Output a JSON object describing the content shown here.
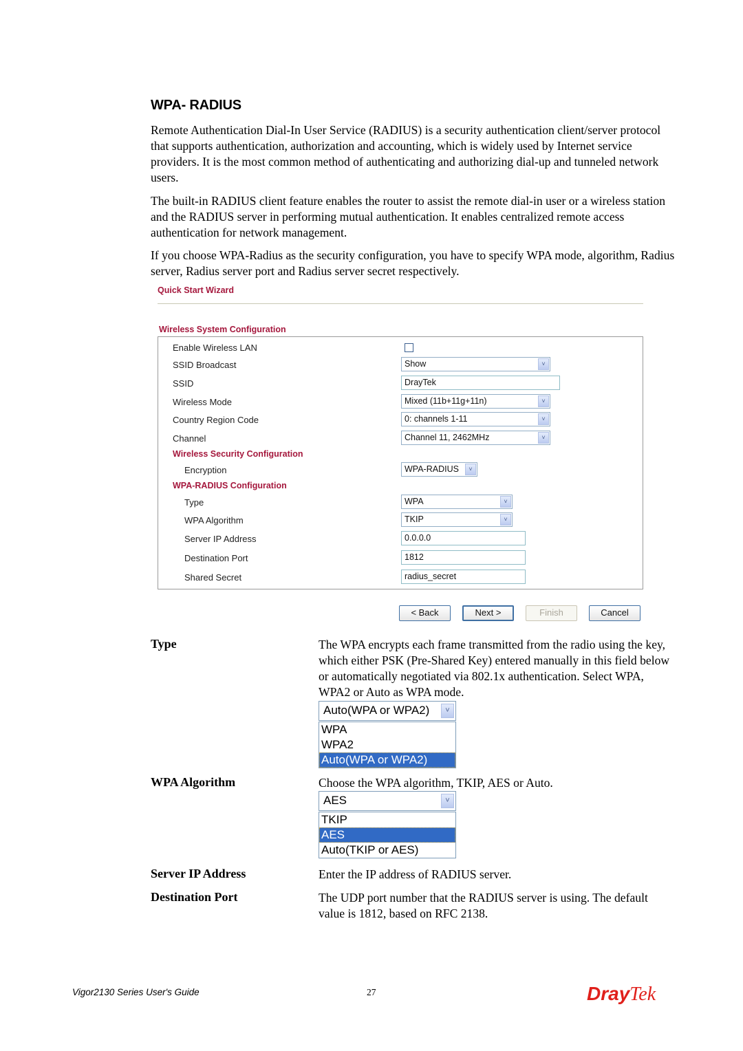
{
  "heading": "WPA- RADIUS",
  "paragraphs": [
    "Remote Authentication Dial-In User Service (RADIUS) is a security authentication client/server protocol that supports authentication, authorization and accounting, which is widely used by Internet service providers. It is the most common method of authenticating and authorizing dial-up and tunneled network users.",
    "The built-in RADIUS client feature enables the router to assist the remote dial-in user or a wireless station and the RADIUS server in performing mutual authentication. It enables centralized remote access authentication for network management.",
    "If you choose WPA-Radius as the security configuration, you have to specify WPA mode, algorithm, Radius server, Radius server port and Radius server secret respectively."
  ],
  "ui": {
    "wizard_title": "Quick Start Wizard",
    "system_section": "Wireless System Configuration",
    "fields": {
      "enable_wlan": {
        "label": "Enable Wireless LAN",
        "checked": false
      },
      "ssid_broadcast": {
        "label": "SSID Broadcast",
        "value": "Show"
      },
      "ssid": {
        "label": "SSID",
        "value": "DrayTek"
      },
      "wireless_mode": {
        "label": "Wireless Mode",
        "value": "Mixed (11b+11g+11n)"
      },
      "country_region": {
        "label": "Country Region Code",
        "value": "0: channels 1-11"
      },
      "channel": {
        "label": "Channel",
        "value": "Channel 11, 2462MHz"
      }
    },
    "security_section": "Wireless Security Configuration",
    "encryption": {
      "label": "Encryption",
      "value": "WPA-RADIUS"
    },
    "radius_section": "WPA-RADIUS Configuration",
    "radius": {
      "type": {
        "label": "Type",
        "value": "WPA"
      },
      "algorithm": {
        "label": "WPA Algorithm",
        "value": "TKIP"
      },
      "server_ip": {
        "label": "Server IP Address",
        "value": "0.0.0.0"
      },
      "port": {
        "label": "Destination Port",
        "value": "1812"
      },
      "secret": {
        "label": "Shared Secret",
        "value": "radius_secret"
      }
    },
    "buttons": {
      "back": "< Back",
      "next": "Next >",
      "finish": "Finish",
      "cancel": "Cancel"
    },
    "arrow_glyph": "˅"
  },
  "definitions": {
    "type": {
      "term": "Type",
      "text": "The WPA encrypts each frame transmitted from the radio using the key, which either PSK (Pre-Shared Key) entered manually in this field below or automatically negotiated via 802.1x authentication. Select WPA, WPA2 or Auto as WPA mode.",
      "dropdown": {
        "selected": "Auto(WPA or WPA2)",
        "options": [
          "WPA",
          "WPA2",
          "Auto(WPA or WPA2)"
        ],
        "highlighted_index": 2
      }
    },
    "algorithm": {
      "term": "WPA Algorithm",
      "text": "Choose the WPA algorithm, TKIP, AES or Auto.",
      "dropdown": {
        "selected": "AES",
        "options": [
          "TKIP",
          "AES",
          "Auto(TKIP or AES)"
        ],
        "highlighted_index": 1
      }
    },
    "server_ip": {
      "term": "Server IP Address",
      "text": "Enter the IP address of RADIUS server."
    },
    "port": {
      "term": "Destination Port",
      "text": "The UDP port number that the RADIUS server is using. The default value is 1812, based on RFC 2138."
    }
  },
  "footer": {
    "guide_title": "Vigor2130 Series User's Guide",
    "page_number": "27",
    "logo_part1": "Dray",
    "logo_part2": "Tek"
  },
  "colors": {
    "brand_red": "#e0201b",
    "section_title": "#a5183d",
    "selection_blue": "#316ac5"
  }
}
